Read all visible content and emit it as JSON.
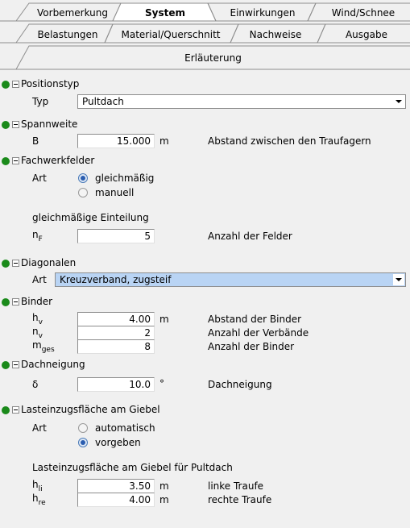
{
  "tabs": {
    "row1": [
      "Vorbemerkung",
      "System",
      "Einwirkungen",
      "Wind/Schnee"
    ],
    "row2": [
      "Belastungen",
      "Material/Querschnitt",
      "Nachweise",
      "Ausgabe"
    ],
    "row3": [
      "Erläuterung"
    ],
    "active": "System"
  },
  "positionstyp": {
    "title": "Positionstyp",
    "typ_label": "Typ",
    "typ_value": "Pultdach"
  },
  "spannweite": {
    "title": "Spannweite",
    "b_label": "B",
    "b_value": "15.000",
    "b_unit": "m",
    "b_desc": "Abstand zwischen den Traufagern"
  },
  "fachwerkfelder": {
    "title": "Fachwerkfelder",
    "art_label": "Art",
    "option1": "gleichmäßig",
    "option2": "manuell",
    "selected": "gleichmäßig",
    "subheading": "gleichmäßige Einteilung",
    "nf_label": "n",
    "nf_sub": "F",
    "nf_value": "5",
    "nf_desc": "Anzahl der Felder"
  },
  "diagonalen": {
    "title": "Diagonalen",
    "art_label": "Art",
    "art_value": "Kreuzverband, zugsteif"
  },
  "binder": {
    "title": "Binder",
    "hv_label": "h",
    "hv_sub": "v",
    "hv_value": "4.00",
    "hv_unit": "m",
    "hv_desc": "Abstand der Binder",
    "nv_label": "n",
    "nv_sub": "v",
    "nv_value": "2",
    "nv_desc": "Anzahl der Verbände",
    "mges_label": "m",
    "mges_sub": "ges",
    "mges_value": "8",
    "mges_desc": "Anzahl der Binder"
  },
  "dachneigung": {
    "title": "Dachneigung",
    "delta_label": "δ",
    "delta_value": "10.0",
    "delta_unit": "°",
    "delta_desc": "Dachneigung"
  },
  "lasteinzug": {
    "title": "Lasteinzugsfläche am Giebel",
    "art_label": "Art",
    "option1": "automatisch",
    "option2": "vorgeben",
    "selected": "vorgeben",
    "subheading": "Lasteinzugsfläche am Giebel für Pultdach",
    "hli_label": "h",
    "hli_sub": "li",
    "hli_value": "3.50",
    "hli_unit": "m",
    "hli_desc": "linke Traufe",
    "hre_label": "h",
    "hre_sub": "re",
    "hre_value": "4.00",
    "hre_unit": "m",
    "hre_desc": "rechte Traufe"
  },
  "colors": {
    "group_dot": "#1a8a1a",
    "highlight": "#b9d4f4",
    "background": "#f0f0f0"
  }
}
